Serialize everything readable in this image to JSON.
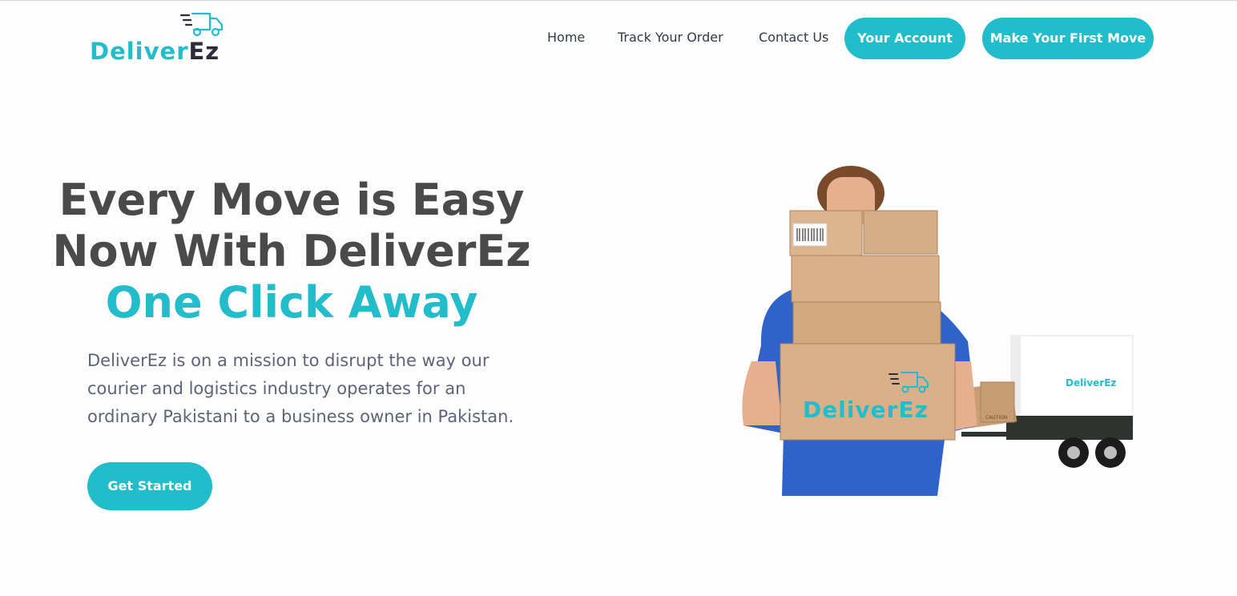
{
  "brand": {
    "name_part1": "Deliver",
    "name_part2": "Ez",
    "primary_color": "#21bdcb",
    "text_color": "#4a4a4a"
  },
  "nav": {
    "home": "Home",
    "track": "Track Your Order",
    "contact": "Contact Us",
    "account_button": "Your Account",
    "first_move_button": "Make Your First Move"
  },
  "hero": {
    "line1": "Every Move is Easy",
    "line2": "Now With DeliverEz",
    "line3": "One Click Away",
    "desc_line1": "DeliverEz is on a mission to disrupt the way our",
    "desc_line2": "courier and logistics industry operates for an",
    "desc_line3": "ordinary Pakistani to a business owner in Pakistan.",
    "cta": "Get Started",
    "box_brand": "DeliverEz",
    "trailer_brand": "DeliverEz",
    "box_stamp": "CAUTION"
  },
  "icons": {
    "logo_icon": "delivery-truck-icon"
  }
}
